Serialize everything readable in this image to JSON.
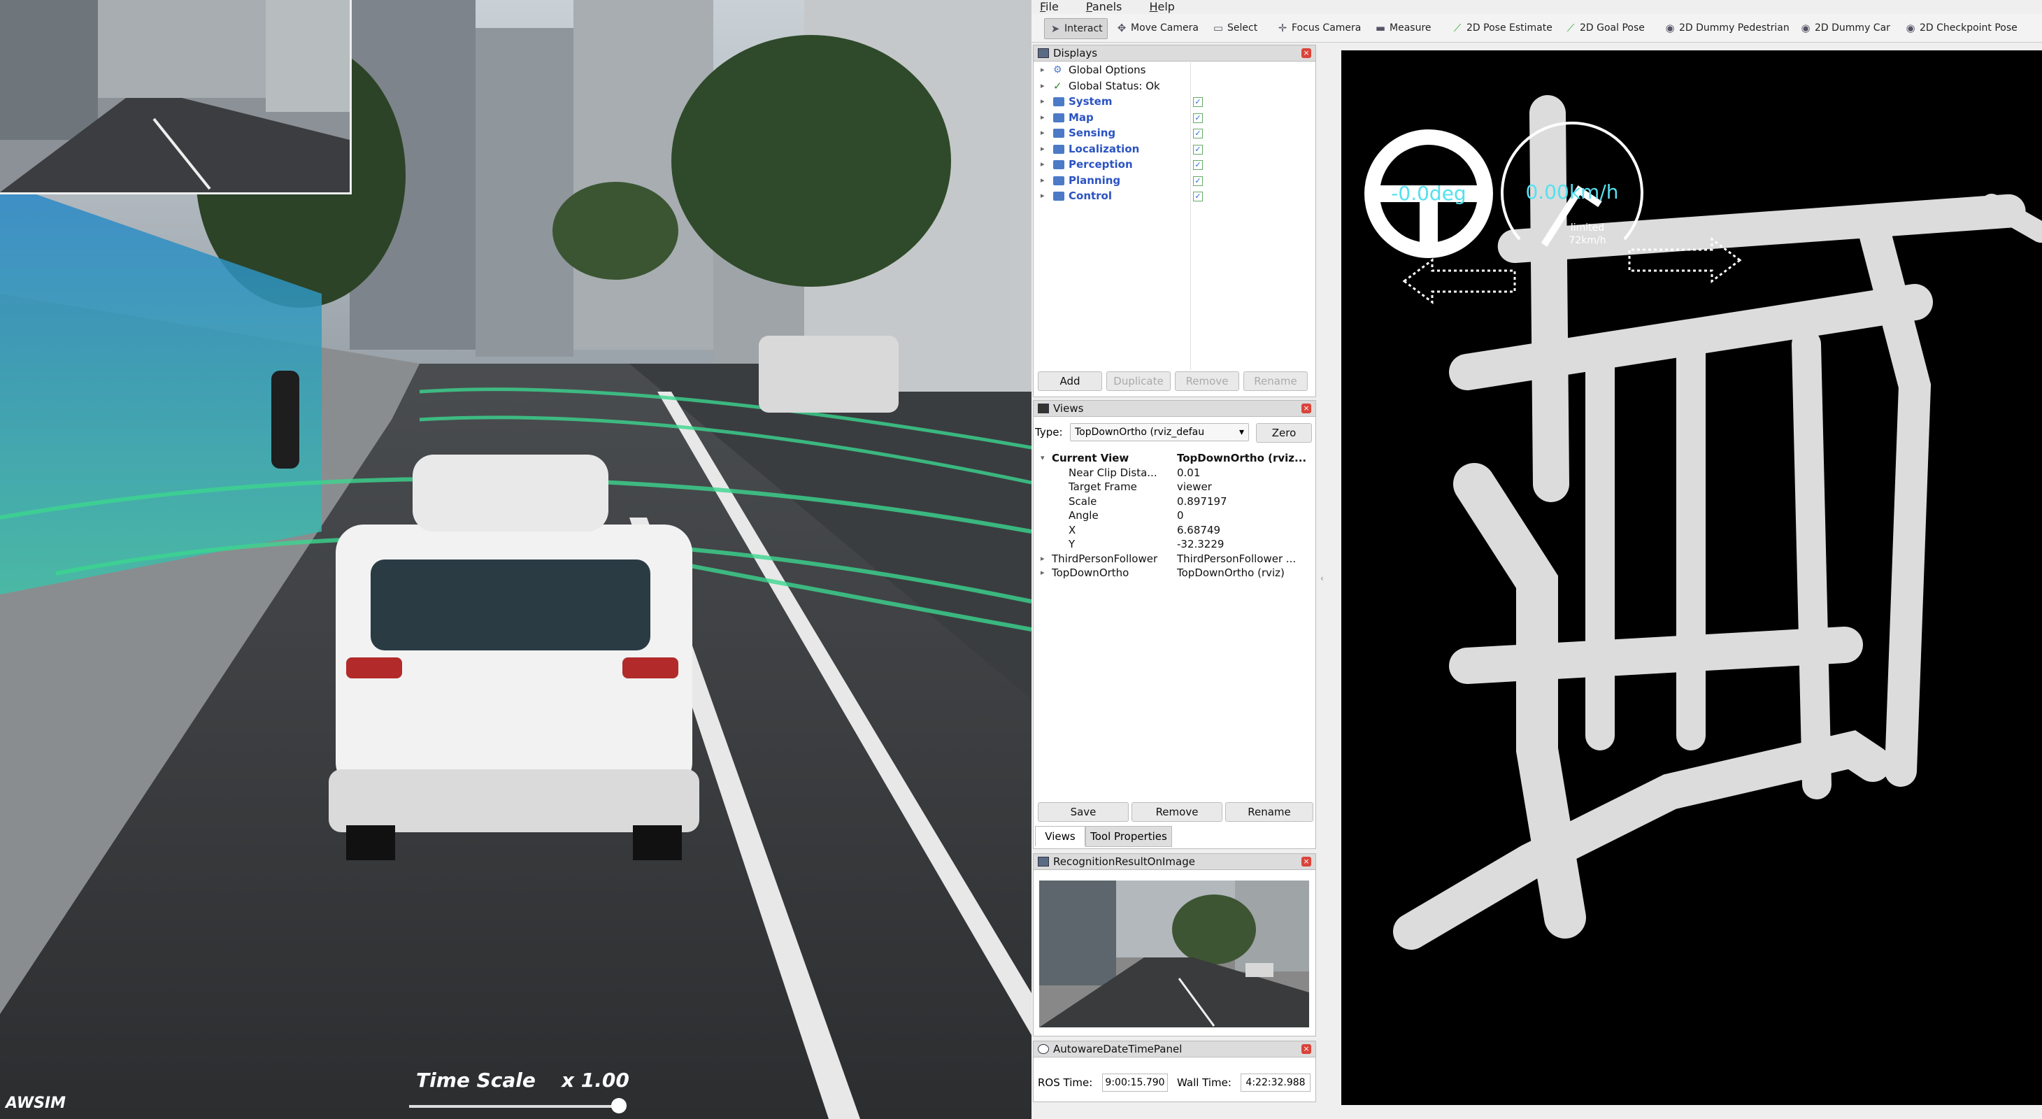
{
  "sim": {
    "app_name": "AWSIM",
    "time_scale_label": "Time Scale",
    "time_scale_value": "x 1.00",
    "time_scale_level": 1.0
  },
  "menu": {
    "file": "File",
    "panels": "Panels",
    "help": "Help"
  },
  "toolbar": [
    {
      "label": "Interact",
      "icon": "cursor-icon",
      "active": true
    },
    {
      "label": "Move Camera",
      "icon": "move-camera-icon"
    },
    {
      "label": "Select",
      "icon": "select-icon"
    },
    {
      "label": "Focus Camera",
      "icon": "focus-camera-icon"
    },
    {
      "label": "Measure",
      "icon": "measure-icon"
    },
    {
      "label": "2D Pose Estimate",
      "icon": "pose-estimate-icon"
    },
    {
      "label": "2D Goal Pose",
      "icon": "goal-pose-icon"
    },
    {
      "label": "2D Dummy Pedestrian",
      "icon": "dummy-pedestrian-icon"
    },
    {
      "label": "2D Dummy Car",
      "icon": "dummy-car-icon"
    },
    {
      "label": "2D Checkpoint Pose",
      "icon": "checkpoint-pose-icon"
    }
  ],
  "displays": {
    "title": "Displays",
    "items": [
      {
        "label": "Global Options",
        "blue": false,
        "icon": "gear-icon"
      },
      {
        "label": "Global Status: Ok",
        "blue": false,
        "icon": "check-icon"
      },
      {
        "label": "System",
        "blue": true,
        "icon": "folder-icon",
        "checked": true
      },
      {
        "label": "Map",
        "blue": true,
        "icon": "folder-icon",
        "checked": true
      },
      {
        "label": "Sensing",
        "blue": true,
        "icon": "folder-icon",
        "checked": true
      },
      {
        "label": "Localization",
        "blue": true,
        "icon": "folder-icon",
        "checked": true
      },
      {
        "label": "Perception",
        "blue": true,
        "icon": "folder-icon",
        "checked": true
      },
      {
        "label": "Planning",
        "blue": true,
        "icon": "folder-icon",
        "checked": true
      },
      {
        "label": "Control",
        "blue": true,
        "icon": "folder-icon",
        "checked": true
      }
    ],
    "buttons": {
      "add": "Add",
      "duplicate": "Duplicate",
      "remove": "Remove",
      "rename": "Rename"
    }
  },
  "views": {
    "title": "Views",
    "type_label": "Type:",
    "type_value": "TopDownOrtho (rviz_defau",
    "zero_label": "Zero",
    "current_view_key": "Current View",
    "current_view_value": "TopDownOrtho (rviz...",
    "props": [
      {
        "k": "Near Clip Dista...",
        "v": "0.01"
      },
      {
        "k": "Target Frame",
        "v": "viewer"
      },
      {
        "k": "Scale",
        "v": "0.897197"
      },
      {
        "k": "Angle",
        "v": "0"
      },
      {
        "k": "X",
        "v": "6.68749"
      },
      {
        "k": "Y",
        "v": "-32.3229"
      }
    ],
    "saved": [
      {
        "k": "ThirdPersonFollower",
        "v": "ThirdPersonFollower ..."
      },
      {
        "k": "TopDownOrtho",
        "v": "TopDownOrtho (rviz)"
      }
    ],
    "save": "Save",
    "remove": "Remove",
    "rename": "Rename",
    "tab_views": "Views",
    "tab_tool_properties": "Tool Properties"
  },
  "recognition": {
    "title": "RecognitionResultOnImage"
  },
  "datetime": {
    "title": "AutowareDateTimePanel",
    "ros_label": "ROS Time:",
    "ros_value": "9:00:15.790",
    "wall_label": "Wall Time:",
    "wall_value": "4:22:32.988"
  },
  "hud": {
    "steering": "-0.0deg",
    "speed": "0.00km/h",
    "limit_label": "limited",
    "limit_value": "72km/h",
    "accent": "#55e0f0"
  }
}
